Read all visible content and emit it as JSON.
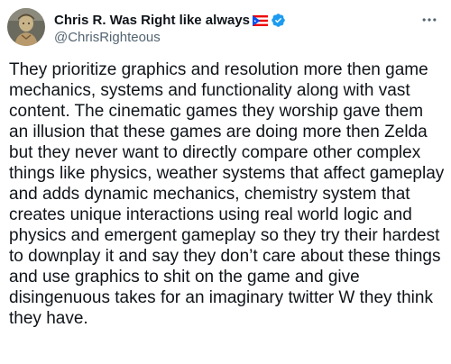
{
  "author": {
    "display_name": "Chris R. Was Right like always",
    "handle": "@ChrisRighteous",
    "verified": true,
    "flag": "puerto-rico-flag",
    "avatar": "avatar-image"
  },
  "menu": {
    "icon": "more-icon"
  },
  "tweet": {
    "text": "They prioritize graphics and resolution more then game mechanics, systems and functionality along with vast content. The cinematic games they worship gave them an illusion that these games are doing more then Zelda but they never want to directly compare other complex things like physics, weather systems that affect gameplay and adds dynamic mechanics, chemistry system that creates unique interactions using real world logic and physics and emergent gameplay so they try their hardest to downplay it and say they don’t care about these things and use graphics to shit on the game and give disingenuous takes for an imaginary twitter W they think they have."
  },
  "colors": {
    "text": "#0f1419",
    "secondary": "#536471",
    "verified": "#1d9bf0"
  }
}
